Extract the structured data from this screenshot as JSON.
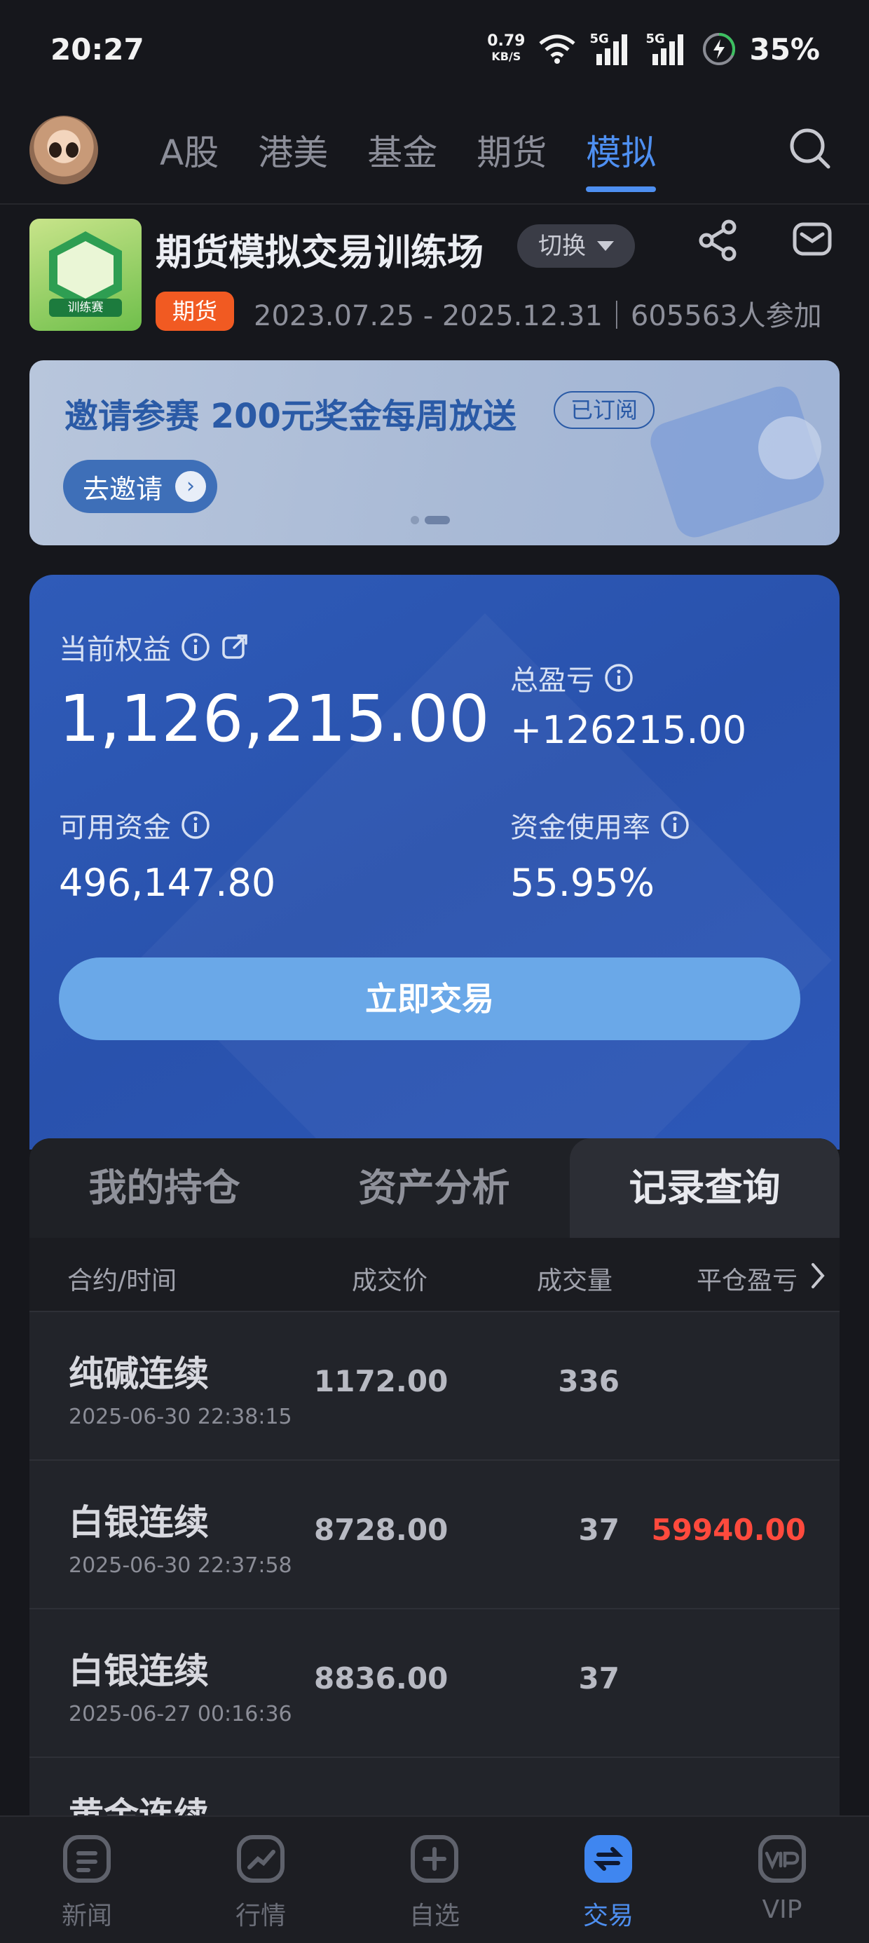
{
  "status_bar": {
    "time": "20:27",
    "net_speed": "0.79",
    "net_unit": "KB/S",
    "signal_1": "5G",
    "signal_2": "5G",
    "battery": "35%"
  },
  "top_tabs": [
    "A股",
    "港美",
    "基金",
    "期货",
    "模拟"
  ],
  "top_tabs_active": "模拟",
  "contest": {
    "title": "期货模拟交易训练场",
    "switch_label": "切换",
    "badge": "期货",
    "meta": "2023.07.25 - 2025.12.31｜605563人参加",
    "logo_ribbon": "训练赛"
  },
  "banner": {
    "title": "邀请参赛 200元奖金每周放送",
    "subscribed": "已订阅",
    "invite_button": "去邀请"
  },
  "account": {
    "equity_label": "当前权益",
    "equity_value": "1,126,215.00",
    "total_pnl_label": "总盈亏",
    "total_pnl_value": "+126215.00",
    "available_label": "可用资金",
    "available_value": "496,147.80",
    "usage_label": "资金使用率",
    "usage_value": "55.95%",
    "trade_button": "立即交易"
  },
  "panel": {
    "tabs": [
      "我的持仓",
      "资产分析",
      "记录查询"
    ],
    "active_tab": "记录查询",
    "columns": [
      "合约/时间",
      "成交价",
      "成交量",
      "平仓盈亏"
    ],
    "rows": [
      {
        "name": "纯碱连续",
        "time": "2025-06-30 22:38:15",
        "price": "1172.00",
        "qty": "336",
        "pnl": ""
      },
      {
        "name": "白银连续",
        "time": "2025-06-30 22:37:58",
        "price": "8728.00",
        "qty": "37",
        "pnl": "59940.00"
      },
      {
        "name": "白银连续",
        "time": "2025-06-27 00:16:36",
        "price": "8836.00",
        "qty": "37",
        "pnl": ""
      },
      {
        "name": "黄金连续",
        "time": "",
        "price": "",
        "qty": "",
        "pnl": ""
      }
    ]
  },
  "colors": {
    "accent": "#4e8ff0",
    "profit": "#ff4a3d",
    "card_blue": "#2d58b8",
    "badge_orange": "#f15a22"
  },
  "bottom_nav": [
    {
      "label": "新闻",
      "icon": "news-icon"
    },
    {
      "label": "行情",
      "icon": "market-icon"
    },
    {
      "label": "自选",
      "icon": "watchlist-add-icon"
    },
    {
      "label": "交易",
      "icon": "trade-icon"
    },
    {
      "label": "VIP",
      "icon": "vip-icon"
    }
  ],
  "bottom_nav_active": "交易"
}
